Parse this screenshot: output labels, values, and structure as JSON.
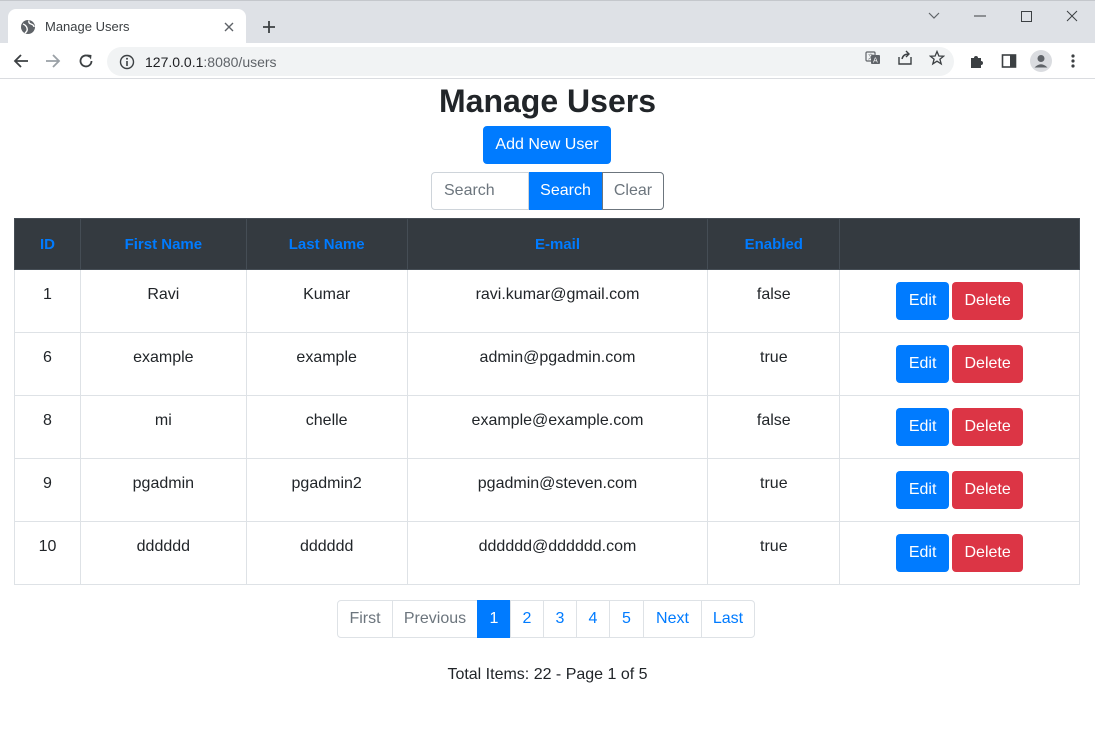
{
  "browser": {
    "tab_title": "Manage Users",
    "url_host": "127.0.0.1",
    "url_path": ":8080/users"
  },
  "icons": {
    "favicon": "globe-icon",
    "tab_close": "close-icon",
    "new_tab": "plus-icon",
    "back": "arrow-left-icon",
    "forward": "arrow-right-icon",
    "reload": "reload-icon",
    "site_info": "info-icon",
    "translate": "translate-icon",
    "share": "share-icon",
    "bookmark": "star-icon",
    "extensions": "puzzle-icon",
    "side_panel": "side-panel-icon",
    "profile": "avatar-icon",
    "menu": "kebab-menu-icon"
  },
  "colors": {
    "primary": "#007bff",
    "danger": "#dc3545",
    "table_header_bg": "#343a40"
  },
  "page": {
    "title": "Manage Users",
    "add_button": "Add New User",
    "search_placeholder": "Search",
    "search_button": "Search",
    "clear_button": "Clear"
  },
  "table": {
    "headers": [
      "ID",
      "First Name",
      "Last Name",
      "E-mail",
      "Enabled",
      ""
    ],
    "rows": [
      {
        "id": "1",
        "first": "Ravi",
        "last": "Kumar",
        "email": "ravi.kumar@gmail.com",
        "enabled": "false",
        "edit": "Edit",
        "delete": "Delete"
      },
      {
        "id": "6",
        "first": "example",
        "last": "example",
        "email": "admin@pgadmin.com",
        "enabled": "true",
        "edit": "Edit",
        "delete": "Delete"
      },
      {
        "id": "8",
        "first": "mi",
        "last": "chelle",
        "email": "example@example.com",
        "enabled": "false",
        "edit": "Edit",
        "delete": "Delete"
      },
      {
        "id": "9",
        "first": "pgadmin",
        "last": "pgadmin2",
        "email": "pgadmin@steven.com",
        "enabled": "true",
        "edit": "Edit",
        "delete": "Delete"
      },
      {
        "id": "10",
        "first": "dddddd",
        "last": "dddddd",
        "email": "dddddd@dddddd.com",
        "enabled": "true",
        "edit": "Edit",
        "delete": "Delete"
      }
    ]
  },
  "pagination": {
    "first": "First",
    "previous": "Previous",
    "pages": [
      "1",
      "2",
      "3",
      "4",
      "5"
    ],
    "current_page": "1",
    "next": "Next",
    "last": "Last"
  },
  "summary": "Total Items: 22 - Page 1 of 5"
}
